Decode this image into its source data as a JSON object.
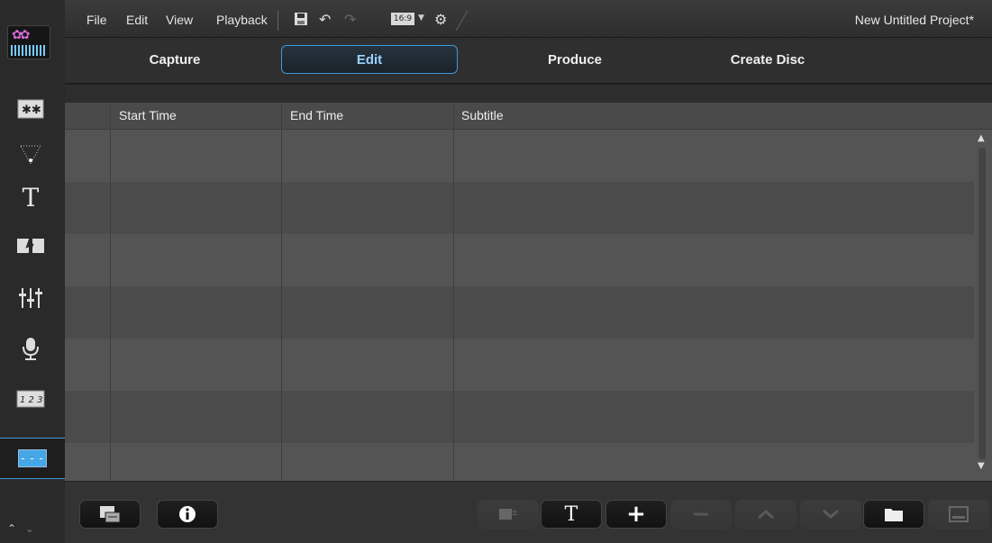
{
  "menubar": {
    "file": "File",
    "edit": "Edit",
    "view": "View",
    "playback": "Playback",
    "aspect_ratio": "16:9",
    "project_title": "New Untitled Project*"
  },
  "tabs": {
    "capture": "Capture",
    "edit": "Edit",
    "produce": "Produce",
    "create_disc": "Create Disc",
    "active": "Edit"
  },
  "subtitle_table": {
    "columns": [
      "Start Time",
      "End Time",
      "Subtitle"
    ],
    "rows": []
  },
  "sidebar": {
    "items": [
      {
        "icon": "effects-icon"
      },
      {
        "icon": "particle-icon"
      },
      {
        "icon": "title-T-icon"
      },
      {
        "icon": "transition-icon"
      },
      {
        "icon": "audio-mixer-icon"
      },
      {
        "icon": "voice-record-icon"
      },
      {
        "icon": "chapter-icon"
      },
      {
        "icon": "subtitle-icon",
        "active": true
      }
    ]
  },
  "colors": {
    "accent": "#3f98d6",
    "active_tab_text": "#9ad3ff",
    "row_light": "#545454",
    "row_dark": "#4b4b4b"
  }
}
